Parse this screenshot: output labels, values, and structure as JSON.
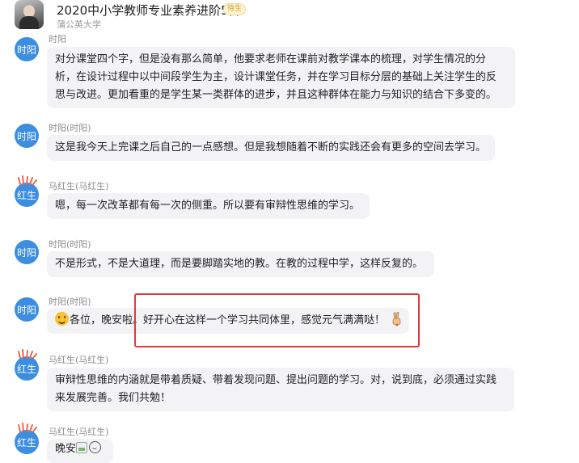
{
  "header": {
    "group_title": "2020中小学教师专业素养进阶5群",
    "group_badge": "待生",
    "group_subtitle": "蒲公英大学"
  },
  "messages": [
    {
      "sender": "时阳",
      "avatar_text": "时阳",
      "lines": [
        "对分课堂四个字，但是没有那么简单，他要求老师在课前对教学课本的梳理，对学生情况的分",
        "析，在设计过程中以中间段学生为主，设计课堂任务，并在学习目标分层的基础上关注学生的反",
        "思与改进。更加看重的是学生某一类群体的进步，并且这种群体在能力与知识的结合下多变的。"
      ]
    },
    {
      "sender": "时阳(时阳)",
      "avatar_text": "时阳",
      "lines": [
        "这是我今天上完课之后自己的一点感想。但是我想随着不断的实践还会有更多的空间去学习。"
      ]
    },
    {
      "sender": "马红生(马红生)",
      "avatar_text": "红生",
      "lines": [
        "嗯，每一次改革都有每一次的侧重。所以要有审辩性思维的学习。"
      ]
    },
    {
      "sender": "时阳(时阳)",
      "avatar_text": "时阳",
      "lines": [
        "不是形式，不是大道理，而是要脚踏实地的教。在教的过程中学，这样反复的。"
      ]
    },
    {
      "sender": "时阳(时阳)",
      "avatar_text": "时阳",
      "lines": [
        "各位，晚安啦。好开心在这样一个学习共同体里，感觉元气满满哒！"
      ]
    },
    {
      "sender": "马红生(马红生)",
      "avatar_text": "红生",
      "lines": [
        "审辩性思维的内涵就是带着质疑、带着发现问题、提出问题的学习。对，说到底，必须通过实践",
        "来发展完善。我们共勉！"
      ]
    },
    {
      "sender": "马红生(马红生)",
      "avatar_text": "红生",
      "lines": [
        "晚安"
      ]
    }
  ],
  "icons": {
    "smile": "smiling-face-emoji",
    "hand": "victory-hand-emoji",
    "broken": "broken-image-icon",
    "face2": "smiley-outline-emoji"
  },
  "colors": {
    "avatar_blue": "#3d8ee0",
    "bubble_bg": "#f3f3f5",
    "highlight": "#e03a3a"
  }
}
